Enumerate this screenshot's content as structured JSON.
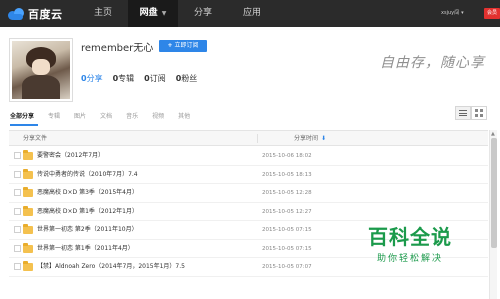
{
  "nav": {
    "logo_text": "百度云",
    "items": [
      "主页",
      "网盘",
      "分享",
      "应用"
    ],
    "active_index": 2,
    "user_name": "xsjuy闯",
    "vip_label": "会员"
  },
  "profile": {
    "username": "remember无心",
    "subscribe_label": "立即订阅",
    "stats": [
      {
        "num": "0",
        "label": "分享"
      },
      {
        "num": "0",
        "label": "专辑"
      },
      {
        "num": "0",
        "label": "订阅"
      },
      {
        "num": "0",
        "label": "粉丝"
      }
    ],
    "slogan": "自由存，随心享"
  },
  "categories": [
    "全部分享",
    "专辑",
    "图片",
    "文档",
    "音乐",
    "视频",
    "其他"
  ],
  "table": {
    "col_name": "分享文件",
    "col_time": "分享时间",
    "rows": [
      {
        "name": "要警密会（2012年7月）",
        "time": "2015-10-06 18:02"
      },
      {
        "name": "传说中勇者的传说（2010年7月）7.4",
        "time": "2015-10-05 18:13"
      },
      {
        "name": "恶魔高校 D×D 第3季（2015年4月）",
        "time": "2015-10-05 12:28"
      },
      {
        "name": "恶魔高校 D×D 第1季（2012年1月）",
        "time": "2015-10-05 12:27"
      },
      {
        "name": "世界第一初恋 第2季（2011年10月）",
        "time": "2015-10-05 07:15"
      },
      {
        "name": "世界第一初恋 第1季（2011年4月）",
        "time": "2015-10-05 07:15"
      },
      {
        "name": "【禁】Aldnoah Zero（2014年7月，2015年1月）7.5",
        "time": "2015-10-05 07:07"
      }
    ]
  },
  "watermark": {
    "title": "百科全说",
    "subtitle": "助你轻松解决"
  }
}
